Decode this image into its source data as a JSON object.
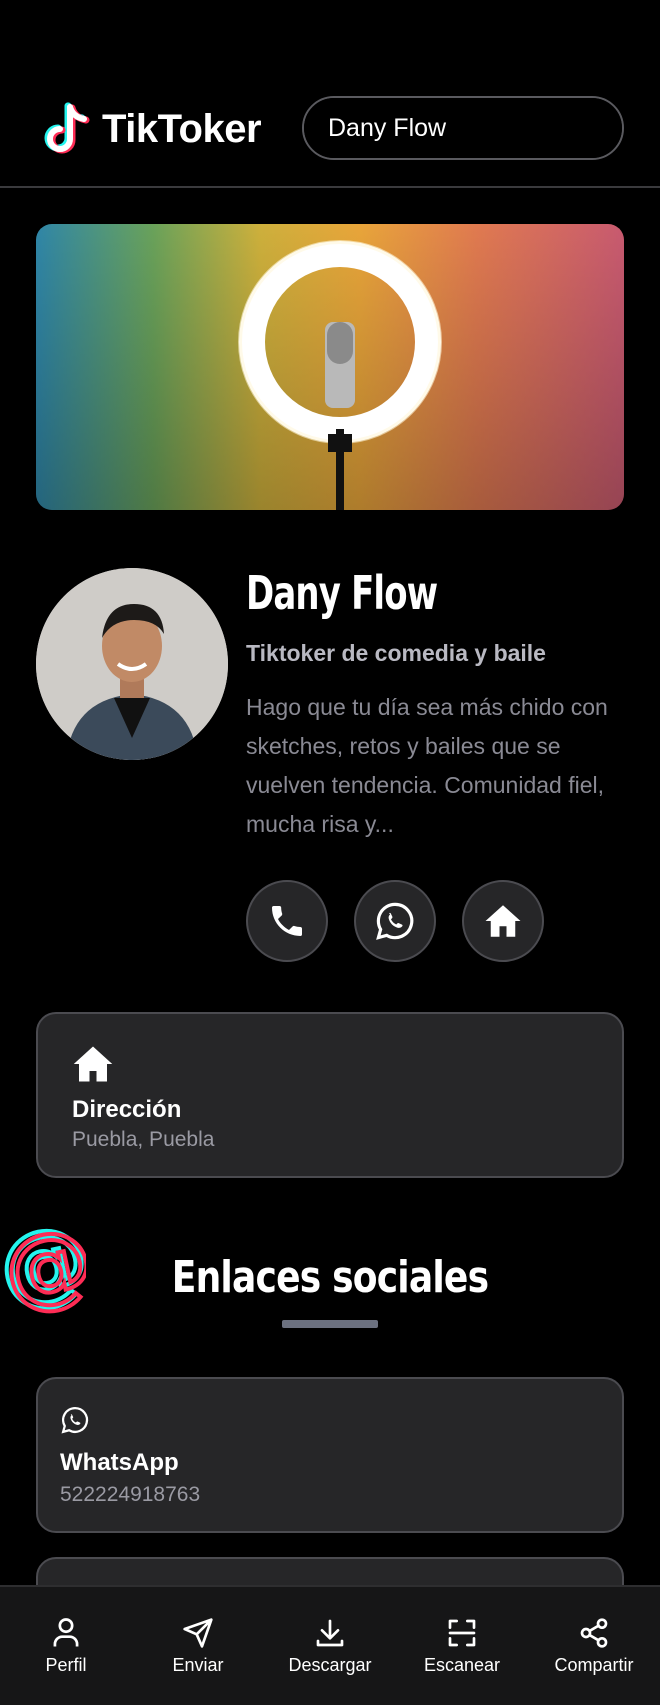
{
  "header": {
    "brand": "TikToker",
    "search_value": "Dany Flow"
  },
  "profile": {
    "name": "Dany Flow",
    "subtitle": "Tiktoker de comedia y baile",
    "bio": "Hago que tu día sea más chido con sketches, retos y bailes que se vuelven tendencia. Comunidad fiel, mucha risa y..."
  },
  "address_card": {
    "title": "Dirección",
    "value": "Puebla, Puebla"
  },
  "social": {
    "section_title": "Enlaces sociales",
    "items": [
      {
        "label": "WhatsApp",
        "value": "522224918763",
        "icon": "whatsapp-icon"
      }
    ]
  },
  "bottom_nav": [
    {
      "label": "Perfil",
      "icon": "user-icon"
    },
    {
      "label": "Enviar",
      "icon": "send-icon"
    },
    {
      "label": "Descargar",
      "icon": "download-icon"
    },
    {
      "label": "Escanear",
      "icon": "scan-icon"
    },
    {
      "label": "Compartir",
      "icon": "share-icon"
    }
  ],
  "colors": {
    "background": "#000000",
    "card": "#262628",
    "accent_cyan": "#25f4ee",
    "accent_pink": "#fe2c55"
  }
}
